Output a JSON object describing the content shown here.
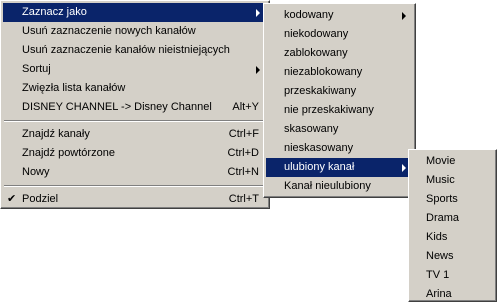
{
  "menu_main": {
    "items": [
      {
        "label": "Zaznacz jako",
        "shortcut": ""
      },
      {
        "label": "Usuń zaznaczenie nowych kanałów",
        "shortcut": ""
      },
      {
        "label": "Usuń zaznaczenie kanałów nieistniejących",
        "shortcut": ""
      },
      {
        "label": "Sortuj",
        "shortcut": ""
      },
      {
        "label": "Zwięzła lista kanałów",
        "shortcut": ""
      },
      {
        "label": "DISNEY CHANNEL -> Disney Channel",
        "shortcut": "Alt+Y"
      },
      {
        "label": "Znajdź kanały",
        "shortcut": "Ctrl+F"
      },
      {
        "label": "Znajdź powtórzone",
        "shortcut": "Ctrl+D"
      },
      {
        "label": "Nowy",
        "shortcut": "Ctrl+N"
      },
      {
        "label": "Podziel",
        "shortcut": "Ctrl+T",
        "checkmark": "✔"
      }
    ]
  },
  "menu_mark_as": {
    "items": [
      {
        "label": "kodowany"
      },
      {
        "label": "niekodowany"
      },
      {
        "label": "zablokowany"
      },
      {
        "label": "niezablokowany"
      },
      {
        "label": "przeskakiwany"
      },
      {
        "label": "nie przeskakiwany"
      },
      {
        "label": "skasowany"
      },
      {
        "label": "nieskasowany"
      },
      {
        "label": "ulubiony kanał"
      },
      {
        "label": "Kanał nieulubiony"
      }
    ]
  },
  "menu_favorite": {
    "items": [
      {
        "label": "Movie"
      },
      {
        "label": "Music"
      },
      {
        "label": "Sports"
      },
      {
        "label": "Drama"
      },
      {
        "label": "Kids"
      },
      {
        "label": "News"
      },
      {
        "label": "TV 1"
      },
      {
        "label": "Arina"
      }
    ]
  },
  "colors": {
    "menu_background": "#d4d0c8",
    "highlight": "#0a246a",
    "highlight_text": "#ffffff"
  }
}
